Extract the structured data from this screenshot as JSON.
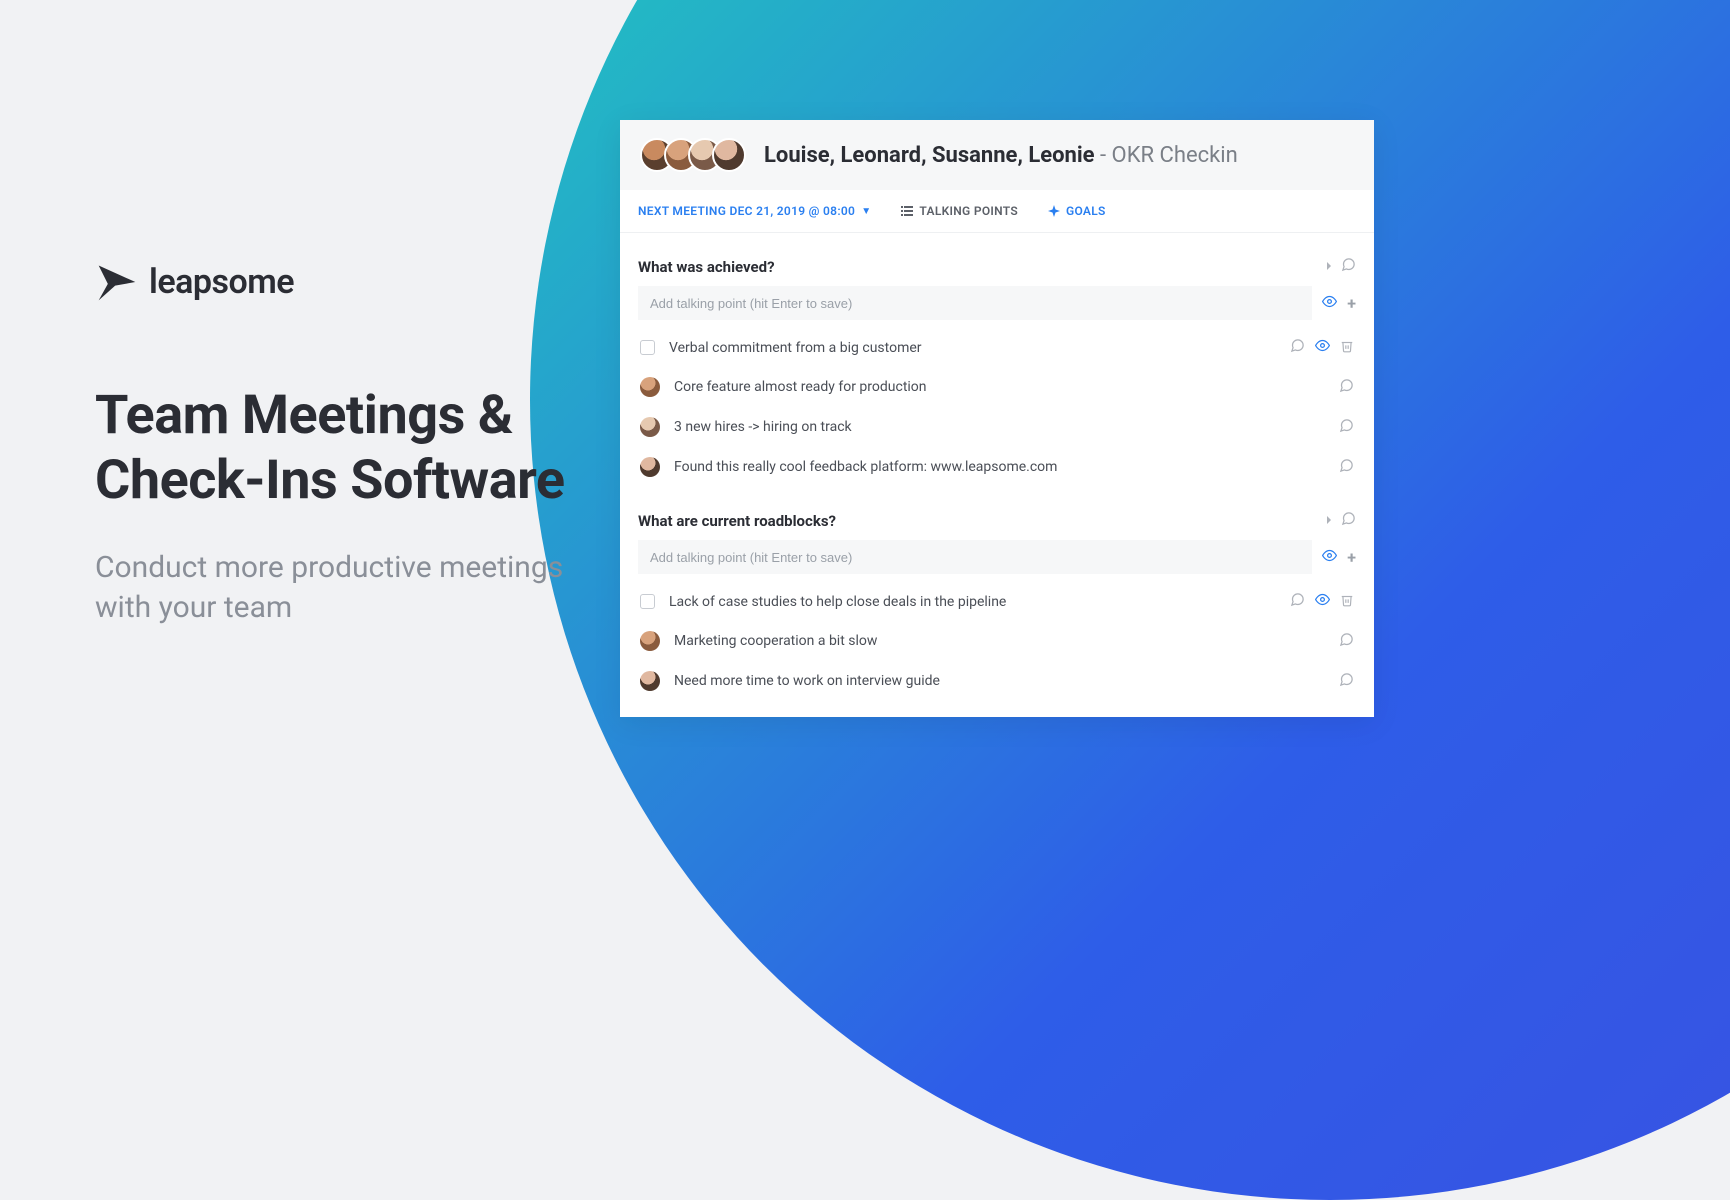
{
  "brand": {
    "name": "leapsome"
  },
  "hero": {
    "headline": "Team Meetings & Check-Ins Software",
    "subhead": "Conduct more productive meetings with your team"
  },
  "meeting": {
    "participants": "Louise, Leonard, Susanne, Leonie",
    "suffix": " - OKR Checkin"
  },
  "tabs": {
    "next_meeting": "NEXT MEETING DEC 21, 2019 @ 08:00",
    "talking_points": "TALKING POINTS",
    "goals": "GOALS"
  },
  "sections": [
    {
      "title": "What was achieved?",
      "placeholder": "Add talking point (hit Enter to save)",
      "items": [
        {
          "type": "checkbox",
          "text": "Verbal commitment from a big customer"
        },
        {
          "type": "avatar",
          "avatar": "av2",
          "text": "Core feature almost ready for production"
        },
        {
          "type": "avatar",
          "avatar": "av3",
          "text": "3 new hires -> hiring on track"
        },
        {
          "type": "avatar",
          "avatar": "av4",
          "text": "Found this really cool feedback platform: www.leapsome.com"
        }
      ]
    },
    {
      "title": "What are current roadblocks?",
      "placeholder": "Add talking point (hit Enter to save)",
      "items": [
        {
          "type": "checkbox",
          "text": "Lack of case studies to help close deals in the pipeline"
        },
        {
          "type": "avatar",
          "avatar": "av2",
          "text": "Marketing cooperation a bit slow"
        },
        {
          "type": "avatar",
          "avatar": "av4",
          "text": "Need more time to work on interview guide"
        }
      ]
    }
  ]
}
